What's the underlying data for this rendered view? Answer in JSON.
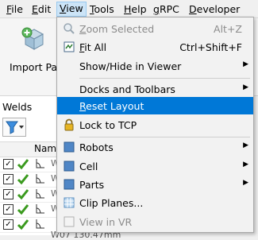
{
  "menubar": {
    "items": [
      {
        "label": "File",
        "mnemonic": "F",
        "rest": "ile"
      },
      {
        "label": "Edit",
        "mnemonic": "E",
        "rest": "dit"
      },
      {
        "label": "View",
        "mnemonic": "V",
        "rest": "iew"
      },
      {
        "label": "Tools",
        "mnemonic": "T",
        "rest": "ools"
      },
      {
        "label": "Help",
        "mnemonic": "H",
        "rest": "elp"
      },
      {
        "label": "gRPC",
        "mnemonic": "g",
        "rest": "RPC"
      },
      {
        "label": "Developer",
        "mnemonic": "D",
        "rest": "eveloper"
      }
    ]
  },
  "toolbar": {
    "import_label": "Import Part",
    "right_tail": "e"
  },
  "welds": {
    "title": "Welds",
    "column_name": "Nam",
    "row_prefix": "W",
    "partial_row": "W07        130.47mm"
  },
  "view_menu": {
    "items": [
      {
        "label": "Zoom Selected",
        "mnemonic": "Z",
        "rest": "oom Selected",
        "shortcut": "Alt+Z",
        "disabled": true,
        "icon": "zoom-icon"
      },
      {
        "label": "Fit All",
        "mnemonic": "F",
        "rest": "it All",
        "shortcut": "Ctrl+Shift+F",
        "icon": "fit-all-icon"
      },
      {
        "label": "Show/Hide in Viewer",
        "submenu": true
      },
      {
        "label": "Docks and Toolbars",
        "submenu": true
      },
      {
        "label": "Reset Layout",
        "mnemonic": "R",
        "rest": "eset Layout",
        "highlighted": true
      },
      {
        "label": "Lock to TCP",
        "icon": "lock-icon"
      },
      {
        "label": "Robots",
        "submenu": true,
        "icon": "robots-icon"
      },
      {
        "label": "Cell",
        "submenu": true,
        "icon": "cell-icon"
      },
      {
        "label": "Parts",
        "submenu": true,
        "icon": "parts-icon"
      },
      {
        "label": "Clip Planes...",
        "icon": "clip-planes-icon"
      },
      {
        "label": "View in VR",
        "disabled": true,
        "icon": "vr-icon"
      }
    ]
  },
  "colors": {
    "highlight": "#0078d7",
    "check_green": "#3a9a1e"
  }
}
